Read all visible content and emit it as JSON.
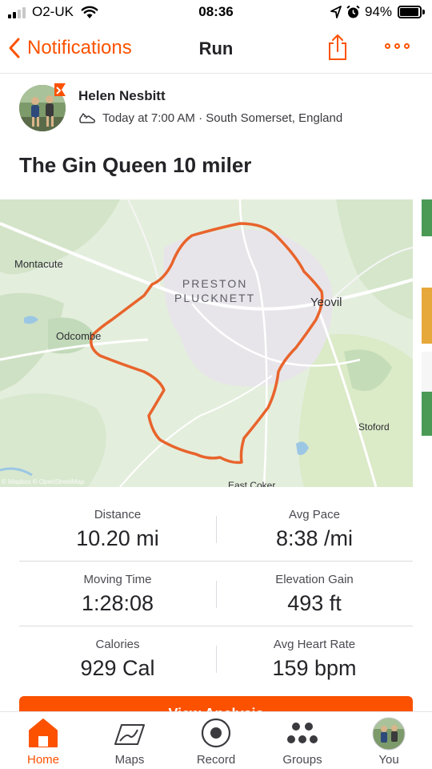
{
  "status_bar": {
    "carrier": "O2-UK",
    "time": "08:36",
    "battery": "94%",
    "icons": [
      "signal-icon",
      "wifi-icon",
      "location-icon",
      "alarm-icon",
      "battery-icon"
    ]
  },
  "nav": {
    "back_label": "Notifications",
    "title": "Run",
    "share_icon": "share-icon",
    "more_icon": "more-icon"
  },
  "athlete": {
    "name": "Helen Nesbitt",
    "meta": "Today at 7:00 AM · South Somerset, England",
    "activity_icon": "running-shoe-icon"
  },
  "activity": {
    "title": "The Gin Queen 10 miler"
  },
  "map": {
    "labels": {
      "montacute": "Montacute",
      "odcombe": "Odcombe",
      "district": "PRESTON\nPLUCKNETT",
      "yeovil": "Yeovil",
      "stoford": "Stoford",
      "east_coker": "East Coker"
    },
    "attribution": "© Mapbox © OpenStreetMap",
    "route_color": "#e8642c"
  },
  "stats": [
    {
      "left": {
        "label": "Distance",
        "value": "10.20 mi"
      },
      "right": {
        "label": "Avg Pace",
        "value": "8:38 /mi"
      }
    },
    {
      "left": {
        "label": "Moving Time",
        "value": "1:28:08"
      },
      "right": {
        "label": "Elevation Gain",
        "value": "493 ft"
      }
    },
    {
      "left": {
        "label": "Calories",
        "value": "929 Cal"
      },
      "right": {
        "label": "Avg Heart Rate",
        "value": "159 bpm"
      }
    }
  ],
  "cta": {
    "label": "View Analysis"
  },
  "tabs": [
    {
      "label": "Home",
      "icon": "home-icon",
      "active": true
    },
    {
      "label": "Maps",
      "icon": "map-icon",
      "active": false
    },
    {
      "label": "Record",
      "icon": "record-icon",
      "active": false
    },
    {
      "label": "Groups",
      "icon": "groups-icon",
      "active": false
    },
    {
      "label": "You",
      "icon": "profile-avatar",
      "active": false
    }
  ],
  "colors": {
    "accent": "#fc5200",
    "text": "#242428"
  }
}
